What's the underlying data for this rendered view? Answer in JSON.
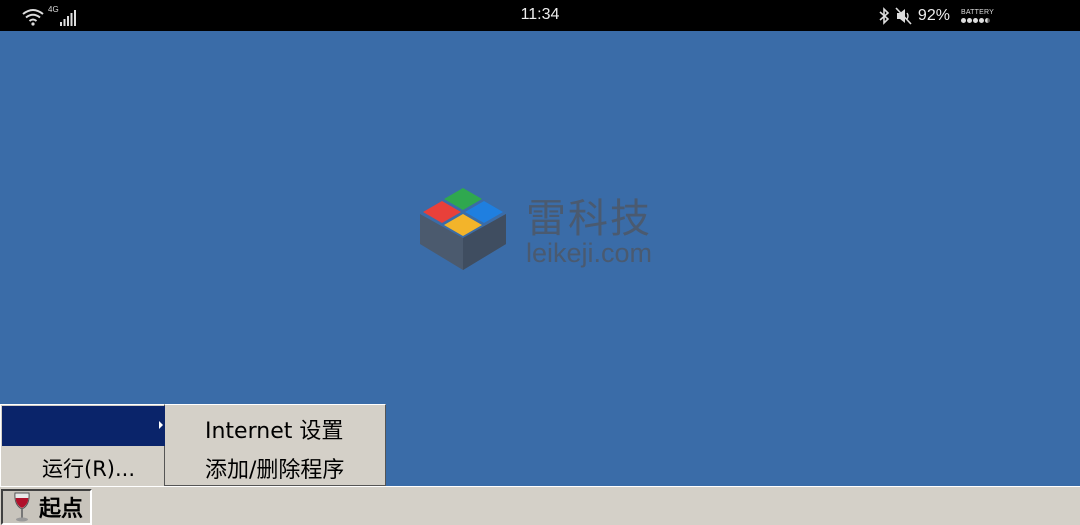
{
  "status_bar": {
    "network_label": "4G",
    "time": "11:34",
    "battery_percent": "92%",
    "battery_label": "BATTERY",
    "icons": [
      "wifi-icon",
      "signal-icon",
      "bluetooth-icon",
      "mute-icon",
      "battery-icon"
    ]
  },
  "watermark": {
    "title": "雷科技",
    "url": "leikeji.com",
    "logo_colors": [
      "#e8403a",
      "#2fa84f",
      "#1f7fe0",
      "#f3b42a"
    ]
  },
  "start_menu": {
    "items": [
      {
        "label": "",
        "has_submenu": true,
        "selected": true
      },
      {
        "label": "运行(R)..."
      }
    ]
  },
  "submenu": {
    "items": [
      {
        "label": "Internet 设置"
      },
      {
        "label": "添加/删除程序"
      }
    ]
  },
  "taskbar": {
    "start_label": "起点",
    "start_icon": "wine-glass-icon"
  },
  "colors": {
    "desktop": "#3a6ca8",
    "menu_face": "#d4d0c8",
    "highlight": "#0a246a"
  }
}
